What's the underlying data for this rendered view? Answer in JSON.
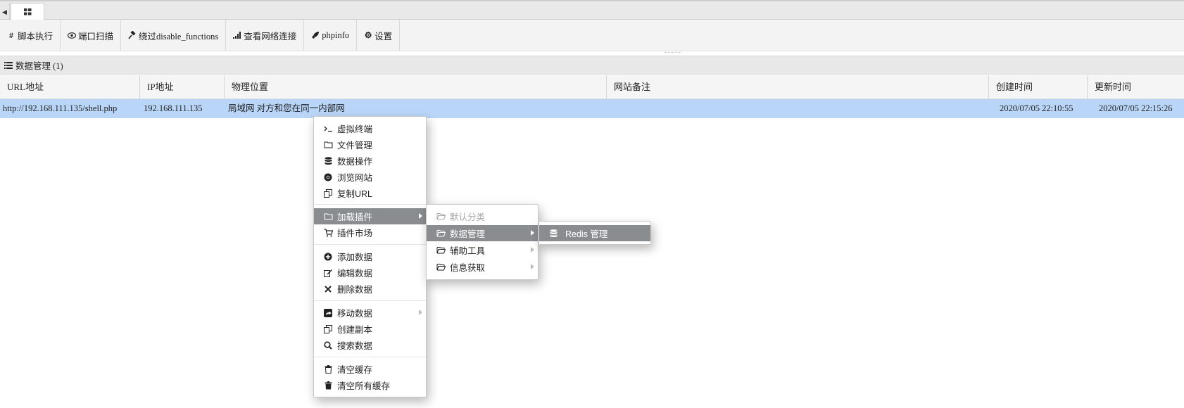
{
  "tabs": {
    "scroll_left_icon": "caret-left-icon",
    "home_icon": "grid-icon"
  },
  "toolbar": {
    "items": [
      {
        "icon": "hashtag-icon",
        "label": "脚本执行"
      },
      {
        "icon": "eye-icon",
        "label": "端口扫描"
      },
      {
        "icon": "hammer-icon",
        "label": "绕过disable_functions"
      },
      {
        "icon": "signal-icon",
        "label": "查看网络连接"
      },
      {
        "icon": "rocket-icon",
        "label": "phpinfo"
      },
      {
        "icon": "gear-icon",
        "label": "设置"
      }
    ]
  },
  "section": {
    "icon": "list-icon",
    "title": "数据管理 (1)"
  },
  "grid": {
    "columns": [
      "URL地址",
      "IP地址",
      "物理位置",
      "网站备注",
      "创建时间",
      "更新时间"
    ],
    "rows": [
      {
        "url": "http://192.168.111.135/shell.php",
        "ip": "192.168.111.135",
        "location": "局域网 对方和您在同一内部网",
        "note": "",
        "created": "2020/07/05 22:10:55",
        "updated": "2020/07/05 22:15:26"
      }
    ],
    "selected_row_color": "#b9d6f8"
  },
  "context_menu": {
    "items": [
      {
        "icon": "terminal-icon",
        "label": "虚拟终端"
      },
      {
        "icon": "folder-icon",
        "label": "文件管理"
      },
      {
        "icon": "database-icon",
        "label": "数据操作"
      },
      {
        "icon": "chrome-icon",
        "label": "浏览网站"
      },
      {
        "icon": "copy-icon",
        "label": "复制URL"
      },
      {
        "icon": "folder-icon",
        "label": "加载插件",
        "submenu": true,
        "active": true
      },
      {
        "icon": "cart-icon",
        "label": "插件市场"
      },
      {
        "icon": "plus-circle-icon",
        "label": "添加数据"
      },
      {
        "icon": "edit-icon",
        "label": "编辑数据"
      },
      {
        "icon": "times-icon",
        "label": "删除数据"
      },
      {
        "icon": "share-icon",
        "label": "移动数据",
        "submenu": true
      },
      {
        "icon": "copy-icon",
        "label": "创建副本"
      },
      {
        "icon": "search-icon",
        "label": "搜索数据"
      },
      {
        "icon": "trash-icon",
        "label": "清空缓存"
      },
      {
        "icon": "trash-icon",
        "label": "清空所有缓存"
      }
    ],
    "active_color": "#8a8d90"
  },
  "plugin_submenu": {
    "items": [
      {
        "icon": "folder-open-icon",
        "label": "默认分类",
        "disabled": true
      },
      {
        "icon": "folder-open-icon",
        "label": "数据管理",
        "submenu": true,
        "active": true
      },
      {
        "icon": "folder-open-icon",
        "label": "辅助工具",
        "submenu": true
      },
      {
        "icon": "folder-open-icon",
        "label": "信息获取",
        "submenu": true
      }
    ]
  },
  "data_submenu": {
    "items": [
      {
        "icon": "database-icon",
        "label": "Redis 管理",
        "active": true
      }
    ]
  }
}
